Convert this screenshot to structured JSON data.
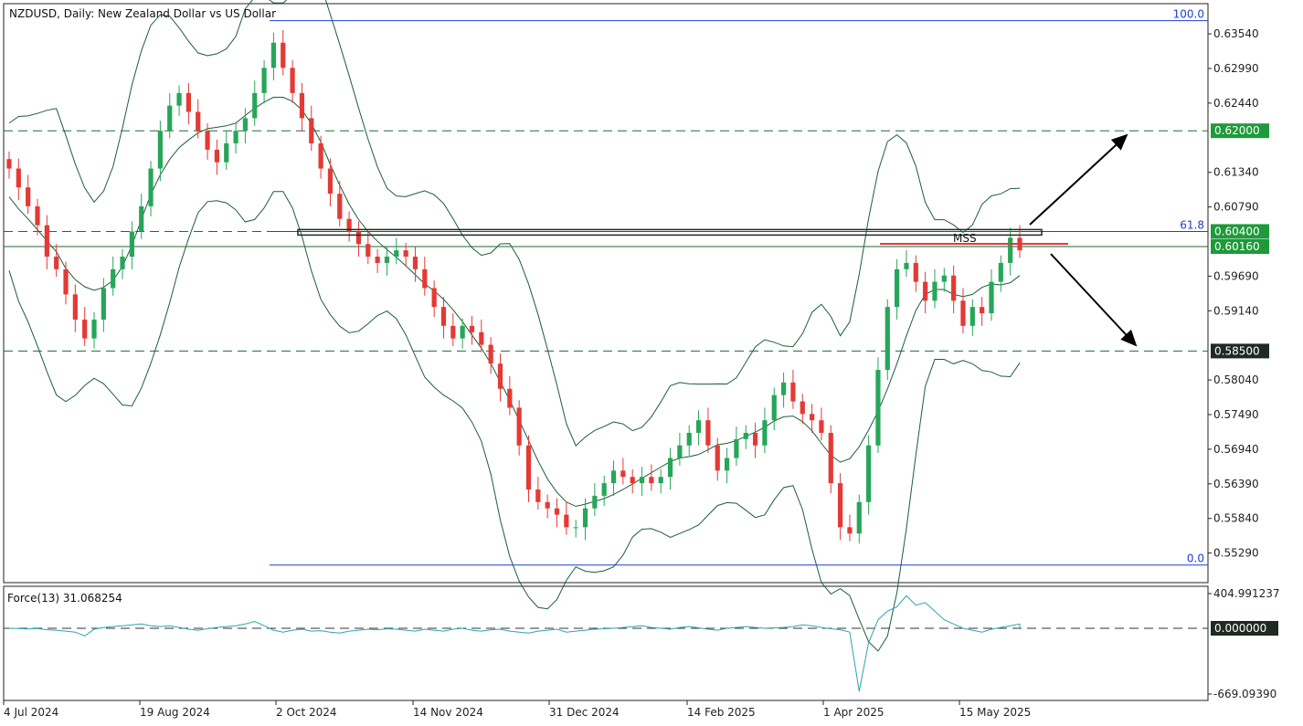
{
  "header": {
    "symbol_title": "NZDUSD, Daily:  New Zealand Dollar vs US Dollar"
  },
  "colors": {
    "bull": "#26a659",
    "bear": "#e53935",
    "band": "#1b5e3a",
    "hline": "#1e6b35",
    "fib": "#1f3fd1",
    "force": "#2aa6b0",
    "red_line": "#e53935",
    "tag_dark": "#1f2a22",
    "tag_green": "#1e9a3a"
  },
  "chart_data": [
    {
      "type": "candlestick",
      "title": "NZDUSD, Daily:  New Zealand Dollar vs US Dollar",
      "xlabel": "",
      "ylabel": "",
      "ylim": [
        0.55,
        0.64
      ],
      "x_ticks": [
        "4 Jul 2024",
        "19 Aug 2024",
        "2 Oct 2024",
        "14 Nov 2024",
        "31 Dec 2024",
        "14 Feb 2025",
        "1 Apr 2025",
        "15 May 2025"
      ],
      "y_ticks": [
        "0.63540",
        "0.62990",
        "0.62440",
        "0.61340",
        "0.60790",
        "0.59690",
        "0.59140",
        "0.58040",
        "0.57490",
        "0.56940",
        "0.56390",
        "0.55840",
        "0.55290"
      ],
      "series": [
        {
          "name": "",
          "close_path": [
            0.614,
            0.611,
            0.608,
            0.605,
            0.6,
            0.598,
            0.594,
            0.59,
            0.587,
            0.59,
            0.595,
            0.598,
            0.6,
            0.604,
            0.608,
            0.614,
            0.62,
            0.624,
            0.626,
            0.623,
            0.62,
            0.617,
            0.615,
            0.618,
            0.62,
            0.622,
            0.626,
            0.63,
            0.634,
            0.63,
            0.626,
            0.622,
            0.618,
            0.614,
            0.61,
            0.606,
            0.604,
            0.602,
            0.6,
            0.599,
            0.6,
            0.601,
            0.6,
            0.598,
            0.595,
            0.592,
            0.589,
            0.587,
            0.589,
            0.588,
            0.586,
            0.583,
            0.579,
            0.576,
            0.57,
            0.563,
            0.561,
            0.56,
            0.559,
            0.557,
            0.557,
            0.56,
            0.562,
            0.564,
            0.566,
            0.565,
            0.564,
            0.565,
            0.564,
            0.565,
            0.568,
            0.57,
            0.572,
            0.574,
            0.57,
            0.566,
            0.568,
            0.571,
            0.572,
            0.57,
            0.574,
            0.578,
            0.58,
            0.577,
            0.575,
            0.574,
            0.572,
            0.564,
            0.557,
            0.556,
            0.561,
            0.57,
            0.582,
            0.592,
            0.598,
            0.599,
            0.596,
            0.593,
            0.596,
            0.597,
            0.593,
            0.589,
            0.592,
            0.591,
            0.596,
            0.599,
            0.603,
            0.601
          ],
          "force_path": [
            0,
            -3,
            -8,
            -2,
            -15,
            -20,
            -30,
            -40,
            -80,
            -10,
            10,
            20,
            30,
            40,
            50,
            30,
            20,
            30,
            10,
            -10,
            -20,
            -5,
            10,
            20,
            30,
            50,
            80,
            30,
            -20,
            -40,
            -20,
            -10,
            -30,
            -25,
            -40,
            -50,
            -30,
            -20,
            -10,
            -15,
            -5,
            -10,
            -20,
            -30,
            -10,
            -20,
            -30,
            -10,
            0,
            -20,
            -30,
            -15,
            -10,
            -30,
            -40,
            -50,
            -30,
            -20,
            -10,
            -40,
            -30,
            -20,
            -10,
            -5,
            0,
            10,
            20,
            30,
            10,
            0,
            -10,
            10,
            20,
            5,
            -10,
            -20,
            0,
            10,
            20,
            10,
            0,
            5,
            10,
            20,
            40,
            30,
            10,
            -5,
            -15,
            -40,
            -660,
            -150,
            100,
            200,
            250,
            380,
            270,
            300,
            200,
            100,
            50,
            0,
            -20,
            -40,
            -10,
            10,
            30,
            50,
            20,
            -10
          ],
          "force_window": "Force(13) 31.068254"
        }
      ],
      "levels": [
        {
          "label": "0.62000",
          "value": 0.62,
          "style": "dashed"
        },
        {
          "label": "0.60400",
          "value": 0.604,
          "style": "dashed"
        },
        {
          "label": "0.60160",
          "value": 0.6016,
          "style": "solid"
        },
        {
          "label": "0.58500",
          "value": 0.585,
          "style": "dashed"
        }
      ],
      "fibonacci": [
        {
          "label": "100.0",
          "value": 0.6375
        },
        {
          "label": "61.8",
          "value": 0.604
        },
        {
          "label": "0.0",
          "value": 0.551
        }
      ],
      "annotations": [
        {
          "text": "MSS",
          "value": 0.6016
        }
      ],
      "grid": false,
      "legend": "none"
    },
    {
      "type": "line",
      "title": "Force(13) 31.068254",
      "y_ticks": [
        "404.991237",
        "0.000000",
        "-669.09390"
      ],
      "ylim": [
        -669.0939,
        404.991237
      ],
      "zero_label": "0.000000"
    }
  ]
}
